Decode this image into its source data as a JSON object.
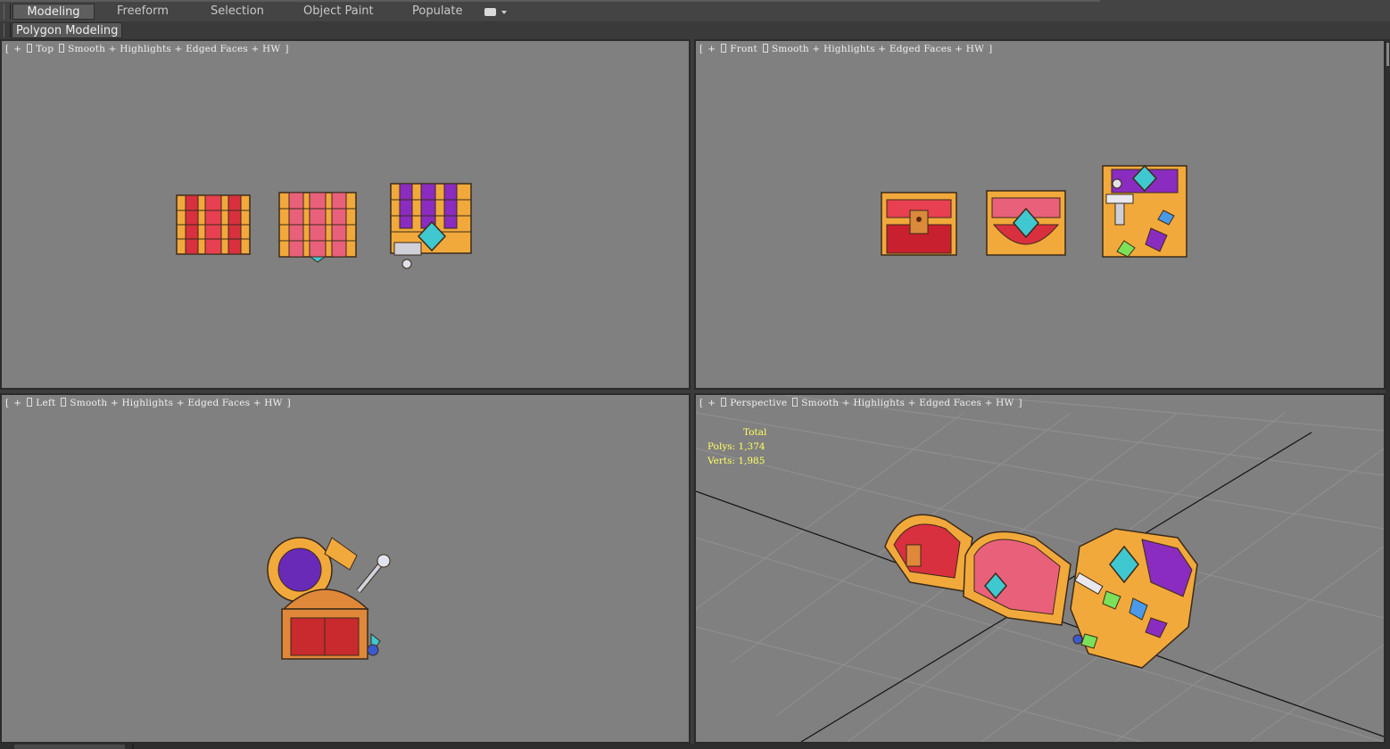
{
  "ribbon": {
    "tabs": [
      {
        "label": "Modeling",
        "active": true
      },
      {
        "label": "Freeform",
        "active": false
      },
      {
        "label": "Selection",
        "active": false
      },
      {
        "label": "Object Paint",
        "active": false
      },
      {
        "label": "Populate",
        "active": false
      }
    ],
    "panel_label": "Polygon Modeling"
  },
  "viewports": {
    "top": {
      "plus": "+",
      "view": "Top",
      "mode": "Smooth + Highlights + Edged Faces + HW"
    },
    "front": {
      "plus": "+",
      "view": "Front",
      "mode": "Smooth + Highlights + Edged Faces + HW"
    },
    "left": {
      "plus": "+",
      "view": "Left",
      "mode": "Smooth + Highlights + Edged Faces + HW"
    },
    "perspective": {
      "plus": "+",
      "view": "Perspective",
      "mode": "Smooth + Highlights + Edged Faces + HW"
    }
  },
  "stats": {
    "total": "Total",
    "polys": "Polys: 1,374",
    "verts": "Verts: 1,985"
  },
  "colors": {
    "viewport_bg": "#808080",
    "stats_text": "#ffff60",
    "chest_gold": "#f2a93b",
    "chest_red": "#d8303f",
    "chest_pink": "#e9607a",
    "chest_purple": "#8a2cc0",
    "gem_teal": "#40c8d0"
  }
}
